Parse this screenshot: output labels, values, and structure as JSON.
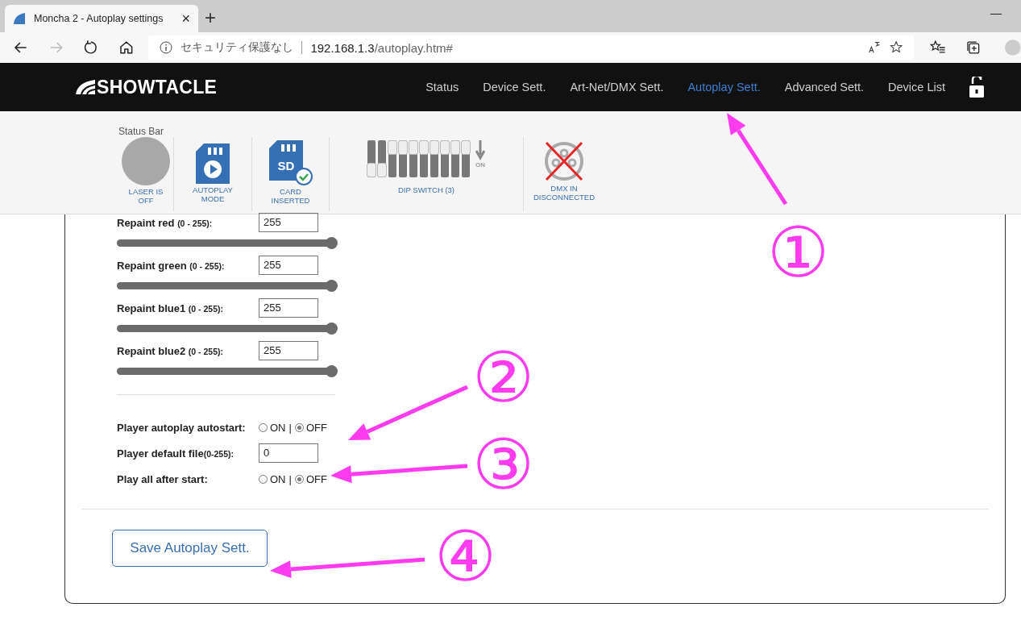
{
  "browser": {
    "tab": {
      "title": "Moncha 2 - Autoplay settings",
      "close": "×"
    },
    "new_tab": "+",
    "minimize": "—",
    "address": {
      "security": "セキュリティ保護なし",
      "host": "192.168.1.3",
      "path": "/autoplay.htm#"
    }
  },
  "nav": {
    "brand": "SHOWTACLE",
    "items": [
      {
        "label": "Status",
        "selected": false
      },
      {
        "label": "Device Sett.",
        "selected": false
      },
      {
        "label": "Art-Net/DMX Sett.",
        "selected": false
      },
      {
        "label": "Autoplay Sett.",
        "selected": true
      },
      {
        "label": "Advanced Sett.",
        "selected": false
      },
      {
        "label": "Device List",
        "selected": false
      }
    ],
    "locked": false
  },
  "status_bar": {
    "title": "Status Bar",
    "items": [
      {
        "kind": "laser",
        "on": false,
        "caption": "LASER IS\nOFF"
      },
      {
        "kind": "autoplay",
        "caption": "AUTOPLAY\nMODE"
      },
      {
        "kind": "card",
        "inserted": true,
        "caption": "CARD\nINSERTED",
        "icon_text": "SD"
      },
      {
        "kind": "dip",
        "caption": "DIP SWITCH (3)",
        "on_label": "ON",
        "switches": [
          {
            "on": true
          },
          {
            "on": true
          },
          {
            "on": false
          },
          {
            "on": false
          },
          {
            "on": false
          },
          {
            "on": false
          },
          {
            "on": false
          },
          {
            "on": false
          },
          {
            "on": false
          },
          {
            "on": false
          }
        ]
      },
      {
        "kind": "dmx",
        "connected": false,
        "caption": "DMX IN\nDISCONNECTED"
      }
    ]
  },
  "colors": [
    {
      "label": "Repaint red",
      "range": "(0 - 255):",
      "value": "255",
      "level": 1
    },
    {
      "label": "Repaint green",
      "range": "(0 - 255):",
      "value": "255",
      "level": 1
    },
    {
      "label": "Repaint blue1",
      "range": "(0 - 255):",
      "value": "255",
      "level": 1
    },
    {
      "label": "Repaint blue2",
      "range": "(0 - 255):",
      "value": "255",
      "level": 1
    }
  ],
  "player": [
    {
      "kind": "radio",
      "label": "Player autoplay autostart:",
      "separator": "|",
      "options": [
        {
          "label": "ON",
          "selected": false
        },
        {
          "label": "OFF",
          "selected": true
        }
      ]
    },
    {
      "kind": "input",
      "label": "Player default file",
      "range": "(0-255):",
      "value": "0"
    },
    {
      "kind": "radio",
      "label": "Play all after start:",
      "separator": "|",
      "options": [
        {
          "label": "ON",
          "selected": false
        },
        {
          "label": "OFF",
          "selected": true
        }
      ]
    }
  ],
  "save_button": "Save Autoplay Sett.",
  "annotations": [
    {
      "label": "①"
    },
    {
      "label": "②"
    },
    {
      "label": "③"
    },
    {
      "label": "④"
    }
  ]
}
